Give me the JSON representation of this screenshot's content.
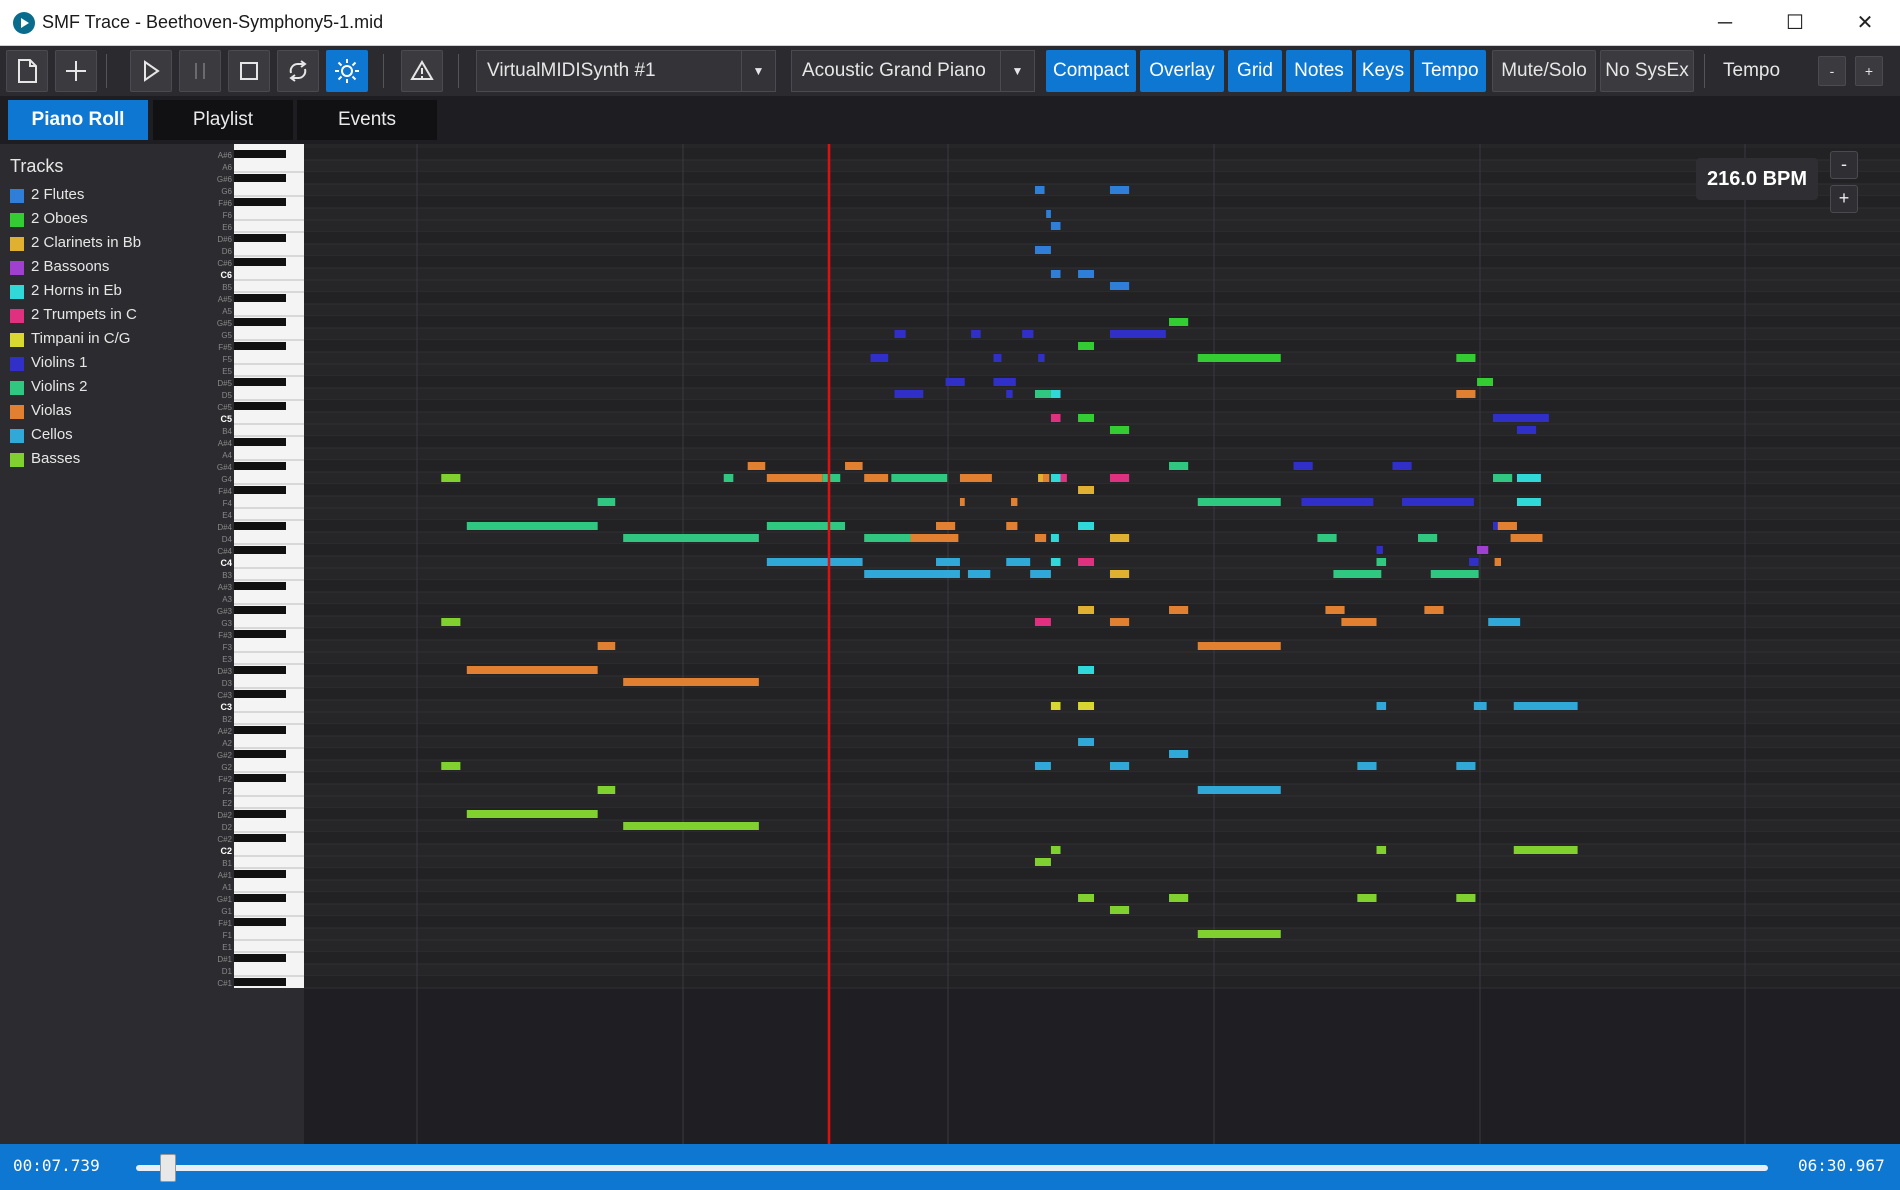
{
  "window": {
    "title": "SMF Trace - Beethoven-Symphony5-1.mid",
    "minimize": "─",
    "maximize": "☐",
    "close": "✕"
  },
  "toolbar": {
    "midi_out": "VirtualMIDISynth #1",
    "instrument": "Acoustic Grand Piano",
    "toggles": [
      {
        "label": "Compact",
        "active": true
      },
      {
        "label": "Overlay",
        "active": true
      },
      {
        "label": "Grid",
        "active": true
      },
      {
        "label": "Notes",
        "active": true
      },
      {
        "label": "Keys",
        "active": true
      },
      {
        "label": "Tempo",
        "active": true
      },
      {
        "label": "Mute/Solo",
        "active": false
      },
      {
        "label": "No SysEx",
        "active": false
      }
    ],
    "tempo_label": "Tempo",
    "tempo_minus": "-",
    "tempo_plus": "+"
  },
  "tabs": [
    "Piano Roll",
    "Playlist",
    "Events"
  ],
  "sidebar": {
    "header": "Tracks",
    "tracks": [
      {
        "name": "2 Flutes",
        "color": "#2f7fd8"
      },
      {
        "name": "2 Oboes",
        "color": "#33cc33"
      },
      {
        "name": "2 Clarinets in Bb",
        "color": "#e0b030"
      },
      {
        "name": "2 Bassoons",
        "color": "#a040d0"
      },
      {
        "name": "2 Horns in Eb",
        "color": "#30d8d8"
      },
      {
        "name": "2 Trumpets in C",
        "color": "#e03080"
      },
      {
        "name": "Timpani in C/G",
        "color": "#d8d830"
      },
      {
        "name": "Violins 1",
        "color": "#3030c8"
      },
      {
        "name": "Violins 2",
        "color": "#30c880"
      },
      {
        "name": "Violas",
        "color": "#e08030"
      },
      {
        "name": "Cellos",
        "color": "#30a8d8"
      },
      {
        "name": "Basses",
        "color": "#80d030"
      }
    ]
  },
  "keyboard": {
    "labels": [
      "A#6",
      "A6",
      "G#6",
      "G6",
      "F#6",
      "F6",
      "E6",
      "D#6",
      "D6",
      "C#6",
      "C6",
      "B5",
      "A#5",
      "A5",
      "G#5",
      "G5",
      "F#5",
      "F5",
      "E5",
      "D#5",
      "D5",
      "C#5",
      "C5",
      "B4",
      "A#4",
      "A4",
      "G#4",
      "G4",
      "F#4",
      "F4",
      "E4",
      "D#4",
      "D4",
      "C#4",
      "C4",
      "B3",
      "A#3",
      "A3",
      "G#3",
      "G3",
      "F#3",
      "F3",
      "E3",
      "D#3",
      "D3",
      "C#3",
      "C3",
      "B2",
      "A#2",
      "A2",
      "G#2",
      "G2",
      "F#2",
      "F2",
      "E2",
      "D#2",
      "D2",
      "C#2",
      "C2",
      "B1",
      "A#1",
      "A1",
      "G#1",
      "G1",
      "F#1",
      "F1",
      "E1",
      "D#1",
      "D1",
      "C#1"
    ]
  },
  "playback": {
    "bpm": "216.0 BPM",
    "zoom_minus": "-",
    "zoom_plus": "+",
    "current_time": "00:07.739",
    "total_time": "06:30.967",
    "position_fraction": 0.0198
  },
  "roll_notes": [
    {
      "track": 11,
      "pitch": "G4",
      "start": 0.086,
      "dur": 0.012
    },
    {
      "track": 11,
      "pitch": "G3",
      "start": 0.086,
      "dur": 0.012
    },
    {
      "track": 11,
      "pitch": "G2",
      "start": 0.086,
      "dur": 0.012
    },
    {
      "track": 8,
      "pitch": "D#4",
      "start": 0.102,
      "dur": 0.082
    },
    {
      "track": 9,
      "pitch": "D#3",
      "start": 0.102,
      "dur": 0.082
    },
    {
      "track": 11,
      "pitch": "D#2",
      "start": 0.102,
      "dur": 0.082
    },
    {
      "track": 8,
      "pitch": "F4",
      "start": 0.184,
      "dur": 0.011
    },
    {
      "track": 9,
      "pitch": "F3",
      "start": 0.184,
      "dur": 0.011
    },
    {
      "track": 11,
      "pitch": "F2",
      "start": 0.184,
      "dur": 0.011
    },
    {
      "track": 8,
      "pitch": "D4",
      "start": 0.2,
      "dur": 0.085
    },
    {
      "track": 9,
      "pitch": "D3",
      "start": 0.2,
      "dur": 0.085
    },
    {
      "track": 11,
      "pitch": "D2",
      "start": 0.2,
      "dur": 0.085
    },
    {
      "track": 8,
      "pitch": "G4",
      "start": 0.263,
      "dur": 0.006
    },
    {
      "track": 9,
      "pitch": "G#4",
      "start": 0.278,
      "dur": 0.011
    },
    {
      "track": 9,
      "pitch": "G4",
      "start": 0.29,
      "dur": 0.035
    },
    {
      "track": 8,
      "pitch": "D#4",
      "start": 0.29,
      "dur": 0.049
    },
    {
      "track": 10,
      "pitch": "C4",
      "start": 0.29,
      "dur": 0.06
    },
    {
      "track": 8,
      "pitch": "G4",
      "start": 0.325,
      "dur": 0.011
    },
    {
      "track": 9,
      "pitch": "G#4",
      "start": 0.339,
      "dur": 0.011
    },
    {
      "track": 9,
      "pitch": "G4",
      "start": 0.351,
      "dur": 0.015
    },
    {
      "track": 8,
      "pitch": "D4",
      "start": 0.351,
      "dur": 0.029
    },
    {
      "track": 10,
      "pitch": "B3",
      "start": 0.351,
      "dur": 0.06
    },
    {
      "track": 8,
      "pitch": "G4",
      "start": 0.368,
      "dur": 0.035
    },
    {
      "track": 9,
      "pitch": "D4",
      "start": 0.38,
      "dur": 0.03
    },
    {
      "track": 7,
      "pitch": "D#5",
      "start": 0.402,
      "dur": 0.012
    },
    {
      "track": 7,
      "pitch": "G5",
      "start": 0.37,
      "dur": 0.007
    },
    {
      "track": 7,
      "pitch": "F5",
      "start": 0.355,
      "dur": 0.011
    },
    {
      "track": 7,
      "pitch": "D5",
      "start": 0.37,
      "dur": 0.018
    },
    {
      "track": 9,
      "pitch": "D#4",
      "start": 0.396,
      "dur": 0.012
    },
    {
      "track": 10,
      "pitch": "C4",
      "start": 0.396,
      "dur": 0.015
    },
    {
      "track": 9,
      "pitch": "G4",
      "start": 0.411,
      "dur": 0.02
    },
    {
      "track": 9,
      "pitch": "F4",
      "start": 0.411,
      "dur": 0.003
    },
    {
      "track": 10,
      "pitch": "B3",
      "start": 0.416,
      "dur": 0.014
    },
    {
      "track": 7,
      "pitch": "G5",
      "start": 0.418,
      "dur": 0.006
    },
    {
      "track": 7,
      "pitch": "F5",
      "start": 0.432,
      "dur": 0.005
    },
    {
      "track": 7,
      "pitch": "D#5",
      "start": 0.432,
      "dur": 0.014
    },
    {
      "track": 7,
      "pitch": "D5",
      "start": 0.44,
      "dur": 0.004
    },
    {
      "track": 9,
      "pitch": "D#4",
      "start": 0.44,
      "dur": 0.007
    },
    {
      "track": 10,
      "pitch": "C4",
      "start": 0.44,
      "dur": 0.015
    },
    {
      "track": 9,
      "pitch": "F4",
      "start": 0.443,
      "dur": 0.004
    },
    {
      "track": 9,
      "pitch": "G4",
      "start": 0.46,
      "dur": 0.007
    },
    {
      "track": 5,
      "pitch": "G4",
      "start": 0.468,
      "dur": 0.01
    },
    {
      "track": 10,
      "pitch": "B3",
      "start": 0.455,
      "dur": 0.013
    },
    {
      "track": 8,
      "pitch": "D5",
      "start": 0.458,
      "dur": 0.01
    },
    {
      "track": 9,
      "pitch": "D4",
      "start": 0.458,
      "dur": 0.007
    },
    {
      "track": 5,
      "pitch": "G3",
      "start": 0.458,
      "dur": 0.01
    },
    {
      "track": 7,
      "pitch": "G5",
      "start": 0.45,
      "dur": 0.007
    },
    {
      "track": 7,
      "pitch": "F5",
      "start": 0.46,
      "dur": 0.004
    },
    {
      "track": 0,
      "pitch": "G6",
      "start": 0.458,
      "dur": 0.006
    },
    {
      "track": 0,
      "pitch": "F6",
      "start": 0.465,
      "dur": 0.003
    },
    {
      "track": 0,
      "pitch": "E6",
      "start": 0.468,
      "dur": 0.006
    },
    {
      "track": 0,
      "pitch": "D6",
      "start": 0.458,
      "dur": 0.01
    },
    {
      "track": 0,
      "pitch": "C6",
      "start": 0.468,
      "dur": 0.006
    },
    {
      "track": 5,
      "pitch": "C5",
      "start": 0.468,
      "dur": 0.006
    },
    {
      "track": 5,
      "pitch": "C4",
      "start": 0.468,
      "dur": 0.006
    },
    {
      "track": 4,
      "pitch": "G4",
      "start": 0.468,
      "dur": 0.006
    },
    {
      "track": 4,
      "pitch": "D4",
      "start": 0.468,
      "dur": 0.005
    },
    {
      "track": 4,
      "pitch": "C4",
      "start": 0.468,
      "dur": 0.006
    },
    {
      "track": 2,
      "pitch": "G4",
      "start": 0.46,
      "dur": 0.003
    },
    {
      "track": 11,
      "pitch": "C2",
      "start": 0.468,
      "dur": 0.006
    },
    {
      "track": 6,
      "pitch": "C3",
      "start": 0.468,
      "dur": 0.006
    },
    {
      "track": 4,
      "pitch": "D5",
      "start": 0.468,
      "dur": 0.006
    },
    {
      "track": 10,
      "pitch": "G2",
      "start": 0.458,
      "dur": 0.01
    },
    {
      "track": 11,
      "pitch": "B1",
      "start": 0.458,
      "dur": 0.01
    },
    {
      "track": 10,
      "pitch": "A2",
      "start": 0.485,
      "dur": 0.01
    },
    {
      "track": 2,
      "pitch": "F#4",
      "start": 0.485,
      "dur": 0.01
    },
    {
      "track": 0,
      "pitch": "C6",
      "start": 0.485,
      "dur": 0.01
    },
    {
      "track": 1,
      "pitch": "F#5",
      "start": 0.485,
      "dur": 0.01
    },
    {
      "track": 1,
      "pitch": "C5",
      "start": 0.485,
      "dur": 0.01
    },
    {
      "track": 4,
      "pitch": "D#4",
      "start": 0.485,
      "dur": 0.01
    },
    {
      "track": 5,
      "pitch": "C4",
      "start": 0.485,
      "dur": 0.01
    },
    {
      "track": 2,
      "pitch": "G#3",
      "start": 0.485,
      "dur": 0.01
    },
    {
      "track": 4,
      "pitch": "D#3",
      "start": 0.485,
      "dur": 0.01
    },
    {
      "track": 6,
      "pitch": "C3",
      "start": 0.485,
      "dur": 0.01
    },
    {
      "track": 11,
      "pitch": "G#1",
      "start": 0.485,
      "dur": 0.01
    },
    {
      "track": 0,
      "pitch": "G6",
      "start": 0.505,
      "dur": 0.012
    },
    {
      "track": 0,
      "pitch": "B5",
      "start": 0.505,
      "dur": 0.012
    },
    {
      "track": 7,
      "pitch": "G5",
      "start": 0.505,
      "dur": 0.035
    },
    {
      "track": 1,
      "pitch": "B4",
      "start": 0.505,
      "dur": 0.012
    },
    {
      "track": 5,
      "pitch": "G4",
      "start": 0.505,
      "dur": 0.012
    },
    {
      "track": 2,
      "pitch": "D4",
      "start": 0.505,
      "dur": 0.012
    },
    {
      "track": 2,
      "pitch": "B3",
      "start": 0.505,
      "dur": 0.012
    },
    {
      "track": 9,
      "pitch": "G3",
      "start": 0.505,
      "dur": 0.012
    },
    {
      "track": 10,
      "pitch": "G2",
      "start": 0.505,
      "dur": 0.012
    },
    {
      "track": 11,
      "pitch": "G1",
      "start": 0.505,
      "dur": 0.012
    },
    {
      "track": 1,
      "pitch": "G#5",
      "start": 0.542,
      "dur": 0.012
    },
    {
      "track": 8,
      "pitch": "G#4",
      "start": 0.542,
      "dur": 0.012
    },
    {
      "track": 9,
      "pitch": "G#3",
      "start": 0.542,
      "dur": 0.012
    },
    {
      "track": 10,
      "pitch": "G#2",
      "start": 0.542,
      "dur": 0.012
    },
    {
      "track": 11,
      "pitch": "G#1",
      "start": 0.542,
      "dur": 0.012
    },
    {
      "track": 1,
      "pitch": "F5",
      "start": 0.56,
      "dur": 0.052
    },
    {
      "track": 8,
      "pitch": "F4",
      "start": 0.56,
      "dur": 0.052
    },
    {
      "track": 9,
      "pitch": "F3",
      "start": 0.56,
      "dur": 0.052
    },
    {
      "track": 10,
      "pitch": "F2",
      "start": 0.56,
      "dur": 0.052
    },
    {
      "track": 11,
      "pitch": "F1",
      "start": 0.56,
      "dur": 0.052
    },
    {
      "track": 7,
      "pitch": "F4",
      "start": 0.625,
      "dur": 0.045
    },
    {
      "track": 7,
      "pitch": "G#4",
      "start": 0.62,
      "dur": 0.012
    },
    {
      "track": 8,
      "pitch": "D4",
      "start": 0.635,
      "dur": 0.012
    },
    {
      "track": 8,
      "pitch": "B3",
      "start": 0.645,
      "dur": 0.03
    },
    {
      "track": 9,
      "pitch": "G#3",
      "start": 0.64,
      "dur": 0.012
    },
    {
      "track": 9,
      "pitch": "G3",
      "start": 0.65,
      "dur": 0.022
    },
    {
      "track": 10,
      "pitch": "G2",
      "start": 0.66,
      "dur": 0.012
    },
    {
      "track": 11,
      "pitch": "C2",
      "start": 0.672,
      "dur": 0.006
    },
    {
      "track": 8,
      "pitch": "C4",
      "start": 0.672,
      "dur": 0.006
    },
    {
      "track": 10,
      "pitch": "C3",
      "start": 0.672,
      "dur": 0.006
    },
    {
      "track": 11,
      "pitch": "G#1",
      "start": 0.66,
      "dur": 0.012
    },
    {
      "track": 7,
      "pitch": "C#4",
      "start": 0.672,
      "dur": 0.004
    },
    {
      "track": 7,
      "pitch": "G#4",
      "start": 0.682,
      "dur": 0.012
    },
    {
      "track": 7,
      "pitch": "F4",
      "start": 0.688,
      "dur": 0.045
    },
    {
      "track": 8,
      "pitch": "D4",
      "start": 0.698,
      "dur": 0.012
    },
    {
      "track": 8,
      "pitch": "B3",
      "start": 0.706,
      "dur": 0.03
    },
    {
      "track": 9,
      "pitch": "G#3",
      "start": 0.702,
      "dur": 0.012
    },
    {
      "track": 10,
      "pitch": "C3",
      "start": 0.733,
      "dur": 0.008
    },
    {
      "track": 10,
      "pitch": "G2",
      "start": 0.722,
      "dur": 0.012
    },
    {
      "track": 11,
      "pitch": "G#1",
      "start": 0.722,
      "dur": 0.012
    },
    {
      "track": 1,
      "pitch": "F5",
      "start": 0.722,
      "dur": 0.012
    },
    {
      "track": 9,
      "pitch": "D5",
      "start": 0.722,
      "dur": 0.012
    },
    {
      "track": 3,
      "pitch": "C#4",
      "start": 0.735,
      "dur": 0.007
    },
    {
      "track": 1,
      "pitch": "D#5",
      "start": 0.735,
      "dur": 0.01
    },
    {
      "track": 7,
      "pitch": "C5",
      "start": 0.745,
      "dur": 0.035
    },
    {
      "track": 7,
      "pitch": "B4",
      "start": 0.76,
      "dur": 0.012
    },
    {
      "track": 9,
      "pitch": "C4",
      "start": 0.746,
      "dur": 0.004
    },
    {
      "track": 7,
      "pitch": "D#4",
      "start": 0.745,
      "dur": 0.012
    },
    {
      "track": 9,
      "pitch": "D#4",
      "start": 0.748,
      "dur": 0.012
    },
    {
      "track": 10,
      "pitch": "G3",
      "start": 0.742,
      "dur": 0.02
    },
    {
      "track": 9,
      "pitch": "D4",
      "start": 0.756,
      "dur": 0.02
    },
    {
      "track": 8,
      "pitch": "G4",
      "start": 0.745,
      "dur": 0.012
    },
    {
      "track": 10,
      "pitch": "C3",
      "start": 0.758,
      "dur": 0.04
    },
    {
      "track": 11,
      "pitch": "C2",
      "start": 0.758,
      "dur": 0.04
    },
    {
      "track": 4,
      "pitch": "G4",
      "start": 0.76,
      "dur": 0.015
    },
    {
      "track": 4,
      "pitch": "F4",
      "start": 0.76,
      "dur": 0.015
    },
    {
      "track": 7,
      "pitch": "C4",
      "start": 0.73,
      "dur": 0.006
    }
  ]
}
